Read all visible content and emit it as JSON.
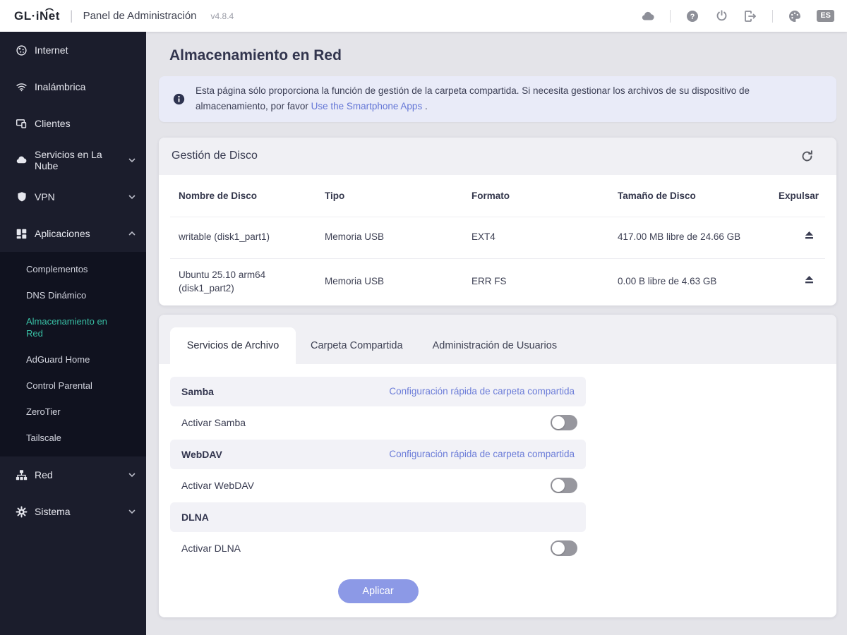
{
  "topbar": {
    "logo": "GL·iNet",
    "title": "Panel de Administración",
    "version": "v4.8.4",
    "language": "ES"
  },
  "sidebar": {
    "items": [
      {
        "label": "Internet"
      },
      {
        "label": "Inalámbrica"
      },
      {
        "label": "Clientes"
      },
      {
        "label": "Servicios en La Nube",
        "chevron": "down"
      },
      {
        "label": "VPN",
        "chevron": "down"
      },
      {
        "label": "Aplicaciones",
        "chevron": "up",
        "expanded": true
      },
      {
        "label": "Red",
        "chevron": "down"
      },
      {
        "label": "Sistema",
        "chevron": "down"
      }
    ],
    "submenu": [
      {
        "label": "Complementos",
        "active": false
      },
      {
        "label": "DNS Dinámico",
        "active": false
      },
      {
        "label": "Almacenamiento en Red",
        "active": true
      },
      {
        "label": "AdGuard Home",
        "active": false
      },
      {
        "label": "Control Parental",
        "active": false
      },
      {
        "label": "ZeroTier",
        "active": false
      },
      {
        "label": "Tailscale",
        "active": false
      }
    ]
  },
  "page": {
    "title": "Almacenamiento en Red",
    "notice_before": "Esta página sólo proporciona la función de gestión de la carpeta compartida. Si necesita gestionar los archivos de su dispositivo de almacenamiento, por favor ",
    "notice_link": "Use the Smartphone Apps",
    "notice_after": " ."
  },
  "disk_card": {
    "title": "Gestión de Disco",
    "columns": {
      "name": "Nombre de Disco",
      "type": "Tipo",
      "format": "Formato",
      "size": "Tamaño de Disco",
      "eject": "Expulsar"
    },
    "rows": [
      {
        "name": "writable (disk1_part1)",
        "type": "Memoria USB",
        "format": "EXT4",
        "size": "417.00 MB libre de 24.66 GB"
      },
      {
        "name": "Ubuntu 25.10 arm64 (disk1_part2)",
        "type": "Memoria USB",
        "format": "ERR FS",
        "size": "0.00 B libre de 4.63 GB"
      }
    ]
  },
  "services_card": {
    "tabs": [
      {
        "label": "Servicios de Archivo",
        "active": true
      },
      {
        "label": "Carpeta Compartida",
        "active": false
      },
      {
        "label": "Administración de Usuarios",
        "active": false
      }
    ],
    "sections": [
      {
        "name": "Samba",
        "link": "Configuración rápida de carpeta compartida",
        "toggle_label": "Activar Samba",
        "enabled": false
      },
      {
        "name": "WebDAV",
        "link": "Configuración rápida de carpeta compartida",
        "toggle_label": "Activar WebDAV",
        "enabled": false
      },
      {
        "name": "DLNA",
        "link": "",
        "toggle_label": "Activar DLNA",
        "enabled": false
      }
    ],
    "apply_label": "Aplicar"
  },
  "colors": {
    "sidebar_bg": "#1b1d2c",
    "submenu_bg": "#10121f",
    "active_item": "#38bfa4",
    "page_bg": "#e4e4e9",
    "notice_bg": "#e9ebf8",
    "link": "#6577d6",
    "apply_button": "#8c99e6",
    "toggle_off": "#97979e"
  }
}
